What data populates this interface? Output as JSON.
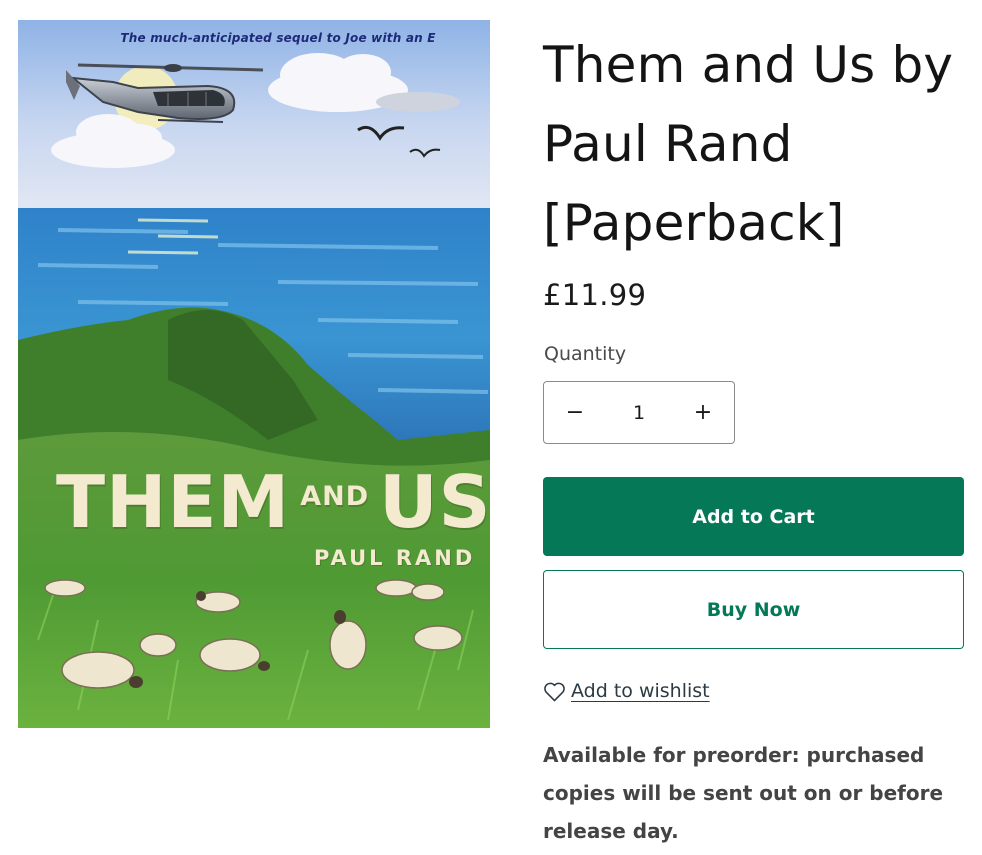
{
  "cover": {
    "tagline": "The much-anticipated sequel to Joe with an E",
    "title_part1": "THEM",
    "title_part2": "AND",
    "title_part3": "US",
    "author": "PAUL RAND"
  },
  "product": {
    "title": "Them and Us by Paul Rand [Paperback]",
    "price": "£11.99"
  },
  "quantity": {
    "label": "Quantity",
    "value": "1",
    "decrease_symbol": "−",
    "increase_symbol": "+"
  },
  "actions": {
    "add_to_cart": "Add to Cart",
    "buy_now": "Buy Now",
    "wishlist": "Add to wishlist"
  },
  "notice": "Available for preorder: purchased copies will be sent out on or before release day.",
  "colors": {
    "accent": "#047857",
    "text": "#1a1a1a",
    "muted": "#444444"
  },
  "icons": {
    "wishlist": "heart-icon",
    "decrease": "minus-icon",
    "increase": "plus-icon"
  }
}
